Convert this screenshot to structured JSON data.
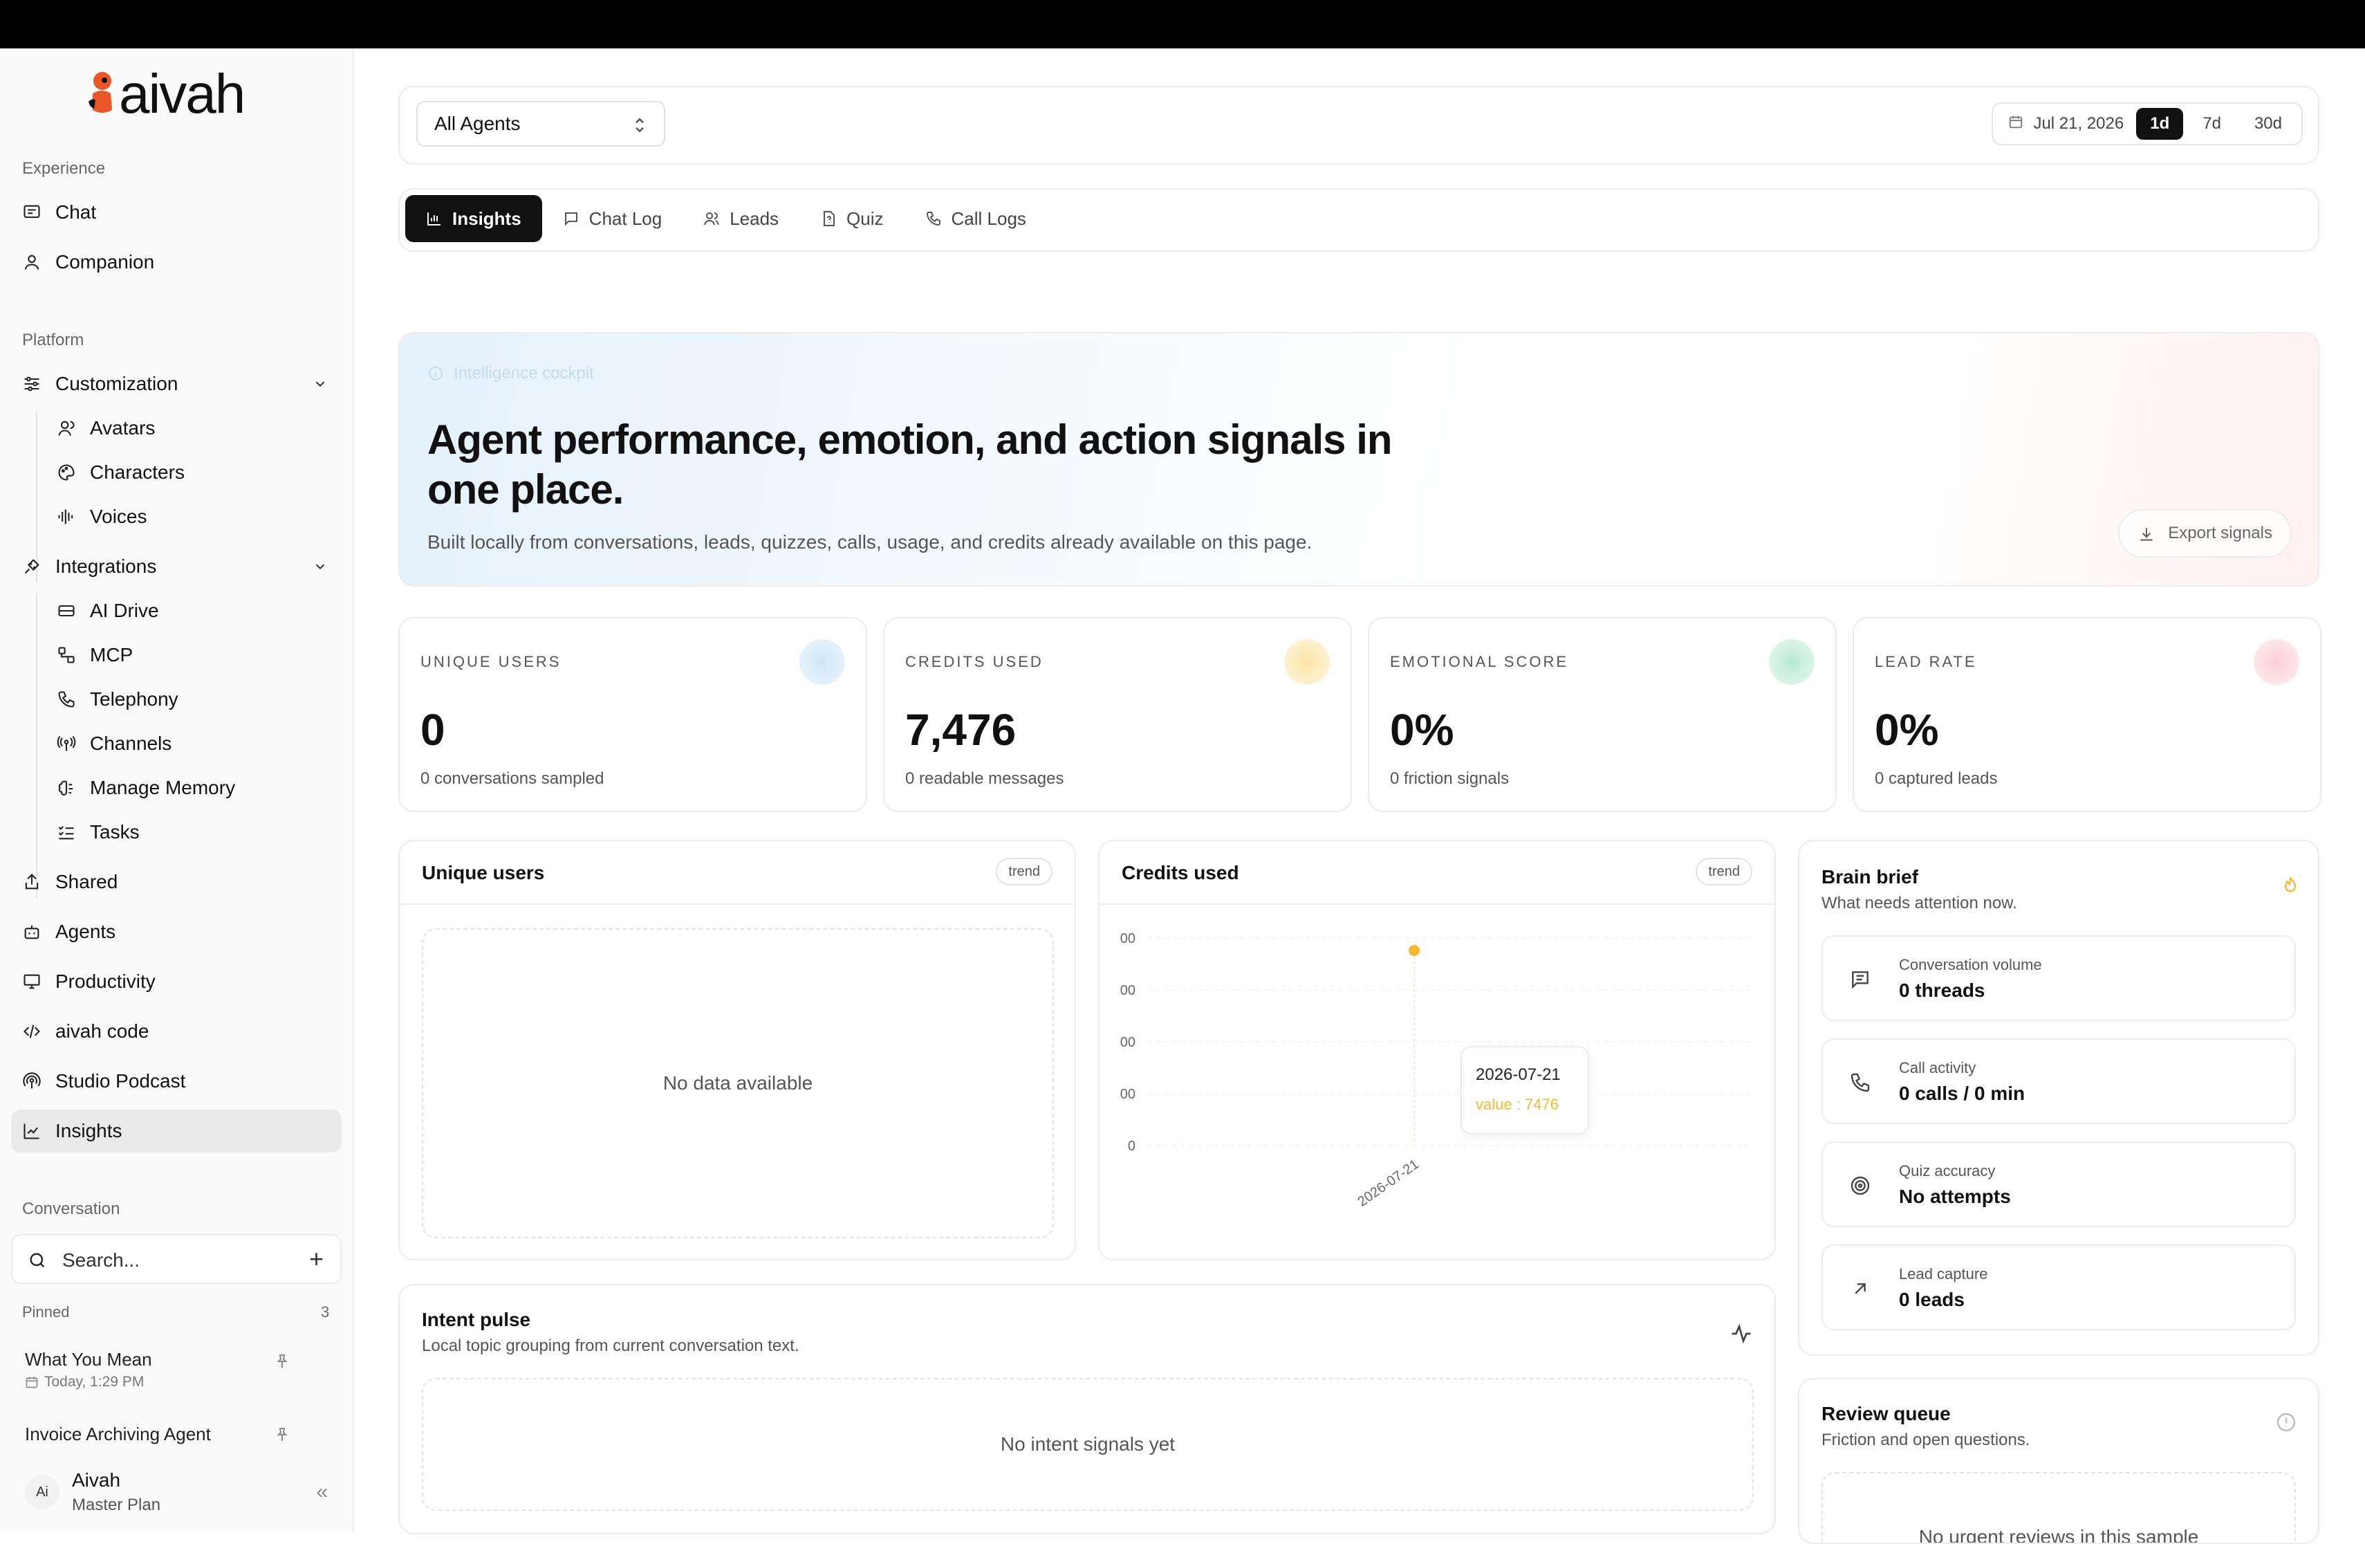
{
  "app": {
    "brand": "aivah"
  },
  "sidebar": {
    "experience_label": "Experience",
    "experience": [
      {
        "label": "Chat"
      },
      {
        "label": "Companion"
      }
    ],
    "platform_label": "Platform",
    "customization": {
      "label": "Customization",
      "children": [
        {
          "label": "Avatars"
        },
        {
          "label": "Characters"
        },
        {
          "label": "Voices"
        }
      ]
    },
    "integrations": {
      "label": "Integrations",
      "children": [
        {
          "label": "AI Drive"
        },
        {
          "label": "MCP"
        },
        {
          "label": "Telephony"
        },
        {
          "label": "Channels"
        },
        {
          "label": "Manage Memory"
        },
        {
          "label": "Tasks"
        }
      ]
    },
    "platform_items": [
      {
        "label": "Shared"
      },
      {
        "label": "Agents"
      },
      {
        "label": "Productivity"
      },
      {
        "label": "aivah code"
      },
      {
        "label": "Studio Podcast"
      },
      {
        "label": "Insights"
      }
    ],
    "conversation_label": "Conversation",
    "search_placeholder": "Search...",
    "pinned_label": "Pinned",
    "pinned_count": "3",
    "pinned": [
      {
        "title": "What You Mean",
        "time": "Today, 1:29 PM"
      },
      {
        "title": "Invoice Archiving Agent"
      }
    ],
    "user": {
      "initials": "Ai",
      "name": "Aivah",
      "plan": "Master Plan"
    }
  },
  "toolbar": {
    "agent_select": "All Agents",
    "date": "Jul 21, 2026",
    "ranges": [
      "1d",
      "7d",
      "30d"
    ],
    "active_range": "1d"
  },
  "tabs": [
    "Insights",
    "Chat Log",
    "Leads",
    "Quiz",
    "Call Logs"
  ],
  "active_tab": "Insights",
  "hero": {
    "chip": "Intelligence cockpit",
    "title": "Agent performance, emotion, and action signals in one place.",
    "subtitle": "Built locally from conversations, leads, quizzes, calls, usage, and credits already available on this page.",
    "export_label": "Export signals"
  },
  "kpis": [
    {
      "title": "UNIQUE USERS",
      "value": "0",
      "sub": "0 conversations sampled",
      "color": "#bcdcf5"
    },
    {
      "title": "CREDITS USED",
      "value": "7,476",
      "sub": "0 readable messages",
      "color": "#fde9b8"
    },
    {
      "title": "EMOTIONAL SCORE",
      "value": "0%",
      "sub": "0 friction signals",
      "color": "#bfe9d6"
    },
    {
      "title": "LEAD RATE",
      "value": "0%",
      "sub": "0 captured leads",
      "color": "#fbd3d6"
    }
  ],
  "unique_users_panel": {
    "title": "Unique users",
    "badge": "trend",
    "empty": "No data available"
  },
  "credits_panel": {
    "title": "Credits used",
    "badge": "trend",
    "tooltip": {
      "date": "2026-07-21",
      "value_label": "value : 7476"
    }
  },
  "chart_data": {
    "type": "line",
    "title": "Credits used",
    "x": [
      "2026-07-21"
    ],
    "series": [
      {
        "values": [
          7476
        ]
      }
    ],
    "y_ticks": [
      "00",
      "00",
      "00",
      "00",
      "0"
    ],
    "x_tick_labels": [
      "2026-07-21"
    ],
    "grid": true,
    "accent": "#f5b82e"
  },
  "brief": {
    "title": "Brain brief",
    "subtitle": "What needs attention now.",
    "items": [
      {
        "label": "Conversation volume",
        "value": "0 threads"
      },
      {
        "label": "Call activity",
        "value": "0 calls / 0 min"
      },
      {
        "label": "Quiz accuracy",
        "value": "No attempts"
      },
      {
        "label": "Lead capture",
        "value": "0 leads"
      }
    ]
  },
  "intent": {
    "title": "Intent pulse",
    "subtitle": "Local topic grouping from current conversation text.",
    "empty": "No intent signals yet"
  },
  "review": {
    "title": "Review queue",
    "subtitle": "Friction and open questions.",
    "empty": "No urgent reviews in this sample"
  }
}
